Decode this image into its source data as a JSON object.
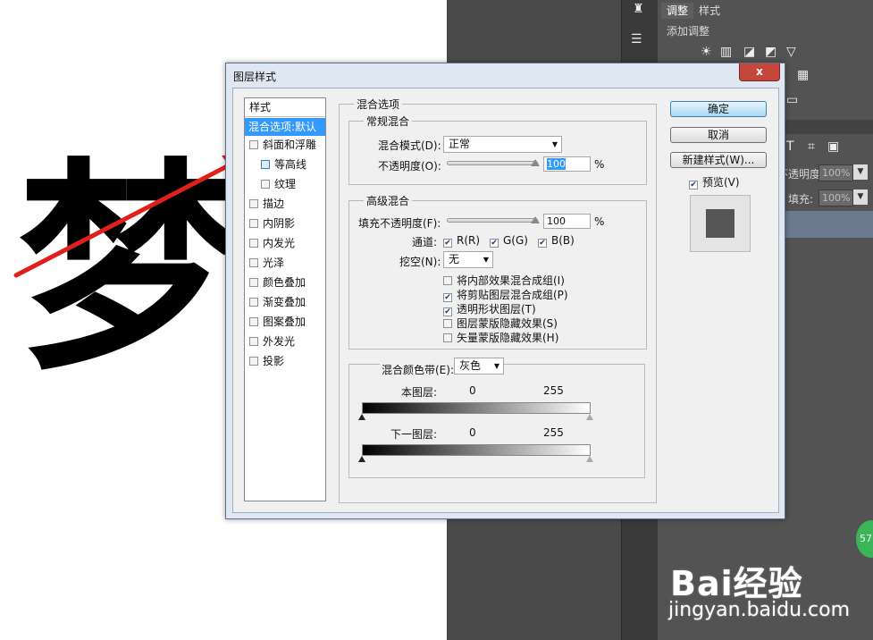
{
  "background": {
    "glyph": "梦",
    "panel_tabs": [
      "调整",
      "样式"
    ],
    "panel_add_label": "添加调整",
    "opacity_label": "不透明度:",
    "opacity_value": "100%",
    "fill_label": "填充:",
    "fill_value": "100%",
    "text_tool_icon": "T"
  },
  "dialog": {
    "title": "图层样式",
    "close_label": "x",
    "styles_header": "样式",
    "styles": [
      {
        "label": "混合选项:默认",
        "selected": true,
        "checkbox": false
      },
      {
        "label": "斜面和浮雕",
        "checkbox": true,
        "checked": false
      },
      {
        "label": "等高线",
        "checkbox": true,
        "checked": false,
        "indent": true
      },
      {
        "label": "纹理",
        "checkbox": true,
        "checked": false,
        "indent": true
      },
      {
        "label": "描边",
        "checkbox": true,
        "checked": false
      },
      {
        "label": "内阴影",
        "checkbox": true,
        "checked": false
      },
      {
        "label": "内发光",
        "checkbox": true,
        "checked": false
      },
      {
        "label": "光泽",
        "checkbox": true,
        "checked": false
      },
      {
        "label": "颜色叠加",
        "checkbox": true,
        "checked": false
      },
      {
        "label": "渐变叠加",
        "checkbox": true,
        "checked": false
      },
      {
        "label": "图案叠加",
        "checkbox": true,
        "checked": false
      },
      {
        "label": "外发光",
        "checkbox": true,
        "checked": false
      },
      {
        "label": "投影",
        "checkbox": true,
        "checked": false
      }
    ],
    "blend_options": {
      "title": "混合选项",
      "general": {
        "title": "常规混合",
        "mode_label": "混合模式(D):",
        "mode_value": "正常",
        "opacity_label": "不透明度(O):",
        "opacity_value": "100",
        "unit": "%"
      },
      "advanced": {
        "title": "高级混合",
        "fill_label": "填充不透明度(F):",
        "fill_value": "100",
        "unit": "%",
        "channels_label": "通道:",
        "channels": [
          "R(R)",
          "G(G)",
          "B(B)"
        ],
        "knockout_label": "挖空(N):",
        "knockout_value": "无",
        "options": [
          {
            "label": "将内部效果混合成组(I)",
            "checked": false
          },
          {
            "label": "将剪贴图层混合成组(P)",
            "checked": true
          },
          {
            "label": "透明形状图层(T)",
            "checked": true
          },
          {
            "label": "图层蒙版隐藏效果(S)",
            "checked": false
          },
          {
            "label": "矢量蒙版隐藏效果(H)",
            "checked": false
          }
        ]
      },
      "blend_if": {
        "label": "混合颜色带(E):",
        "value": "灰色",
        "this_layer_label": "本图层:",
        "underlying_label": "下一图层:",
        "min": "0",
        "max": "255"
      }
    },
    "buttons": {
      "ok": "确定",
      "cancel": "取消",
      "new_style": "新建样式(W)...",
      "preview": "预览(V)"
    }
  },
  "watermark": {
    "logo": "Bai经验",
    "url": "jingyan.baidu.com",
    "badge": "57"
  }
}
